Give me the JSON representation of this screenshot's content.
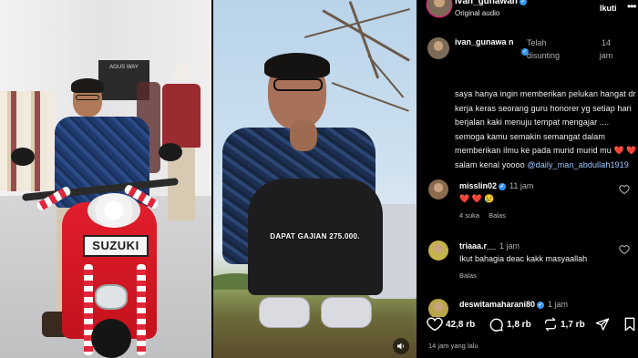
{
  "photo_left": {
    "plate_text": "SUZUKI",
    "store_sign": "AGUS WAY"
  },
  "video": {
    "caption": "DAPAT GAJIAN 275.000."
  },
  "header": {
    "username": "ivan_gunawan",
    "audio_label": "Original audio",
    "follow_label": "Ikuti",
    "more_icon": "more-dots-icon"
  },
  "main_comment": {
    "username": "ivan_gunawa n",
    "edited": "Telah disunting",
    "time": "14 jam",
    "text": "saya hanya  ingin memberikan pelukan hangat dr  kerja keras seorang guru honorer yg setiap hari berjalan kaki menuju  tempat  mengajar .... semoga  kamu  semakin semangat dalam  memberikan ilmu  ke pada murid murid mu ",
    "text_tail": " salam  kenal yoooo ",
    "emoji_hearts": "❤️ ❤️",
    "mention": "@daily_man_abdullah1919"
  },
  "replies": [
    {
      "username": "misslin02",
      "verified": true,
      "time": "11 jam",
      "text": "❤️ ❤️ 😢",
      "likes": "4 suka",
      "reply_label": "Balas"
    },
    {
      "username": "triaaa.r__",
      "verified": false,
      "time": "1 jam",
      "text": "Ikut bahagia deac kakk masyaallah",
      "likes": "",
      "reply_label": "Balas"
    },
    {
      "username": "deswitamaharani80",
      "verified": true,
      "time": "1 jam",
      "text": "",
      "likes": "",
      "reply_label": ""
    }
  ],
  "stats": {
    "likes": "42,8 rb",
    "comments": "1,8 rb",
    "reposts": "1,7 rb"
  },
  "post_date": "14 jam yang lalu",
  "colors": {
    "panel_bg": "#000000",
    "verified_blue": "#3797f0",
    "heart_red": "#ff3040",
    "mention_blue": "#9ec8ff",
    "scooter_red": "#e11e2b"
  }
}
